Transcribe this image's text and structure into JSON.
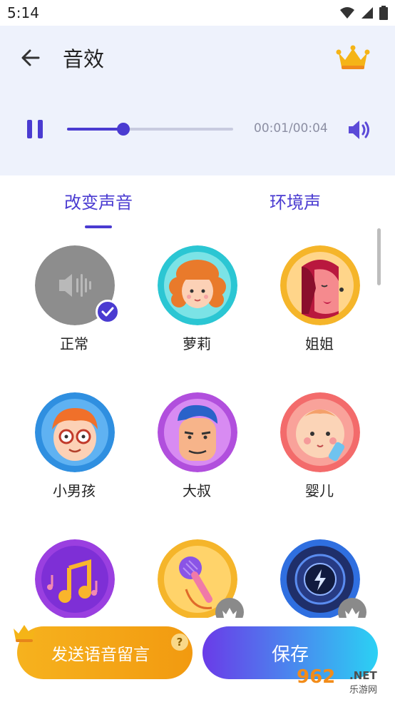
{
  "status_bar": {
    "time": "5:14",
    "icons": [
      "wifi-icon",
      "signal-icon",
      "battery-icon"
    ]
  },
  "header": {
    "title": "音效",
    "back_icon": "arrow-left-icon",
    "vip_icon": "crown-icon"
  },
  "player": {
    "state_icon": "pause-icon",
    "timecode": "00:01/00:04",
    "progress": 0.34,
    "volume_icon": "speaker-icon"
  },
  "tabs": [
    {
      "label": "改变声音",
      "selected": true
    },
    {
      "label": "环境声",
      "selected": false
    }
  ],
  "effects": [
    {
      "label": "正常",
      "selected": true,
      "locked": false
    },
    {
      "label": "萝莉",
      "selected": false,
      "locked": false
    },
    {
      "label": "姐姐",
      "selected": false,
      "locked": false
    },
    {
      "label": "小男孩",
      "selected": false,
      "locked": false
    },
    {
      "label": "大叔",
      "selected": false,
      "locked": false
    },
    {
      "label": "婴儿",
      "selected": false,
      "locked": false
    },
    {
      "label": "",
      "selected": false,
      "locked": false
    },
    {
      "label": "",
      "selected": false,
      "locked": true
    },
    {
      "label": "",
      "selected": false,
      "locked": true
    }
  ],
  "actions": {
    "send_voice": "发送语音留言",
    "save": "保存",
    "help": "?"
  },
  "watermark": {
    "number": "962",
    "net": ".NET",
    "site": "乐游网"
  },
  "colors": {
    "accent": "#4a3bd1",
    "header_bg": "#eef2fc",
    "send_button": "#f4a71a",
    "save_button_start": "#6a3be8",
    "save_button_end": "#2bd1f4"
  }
}
